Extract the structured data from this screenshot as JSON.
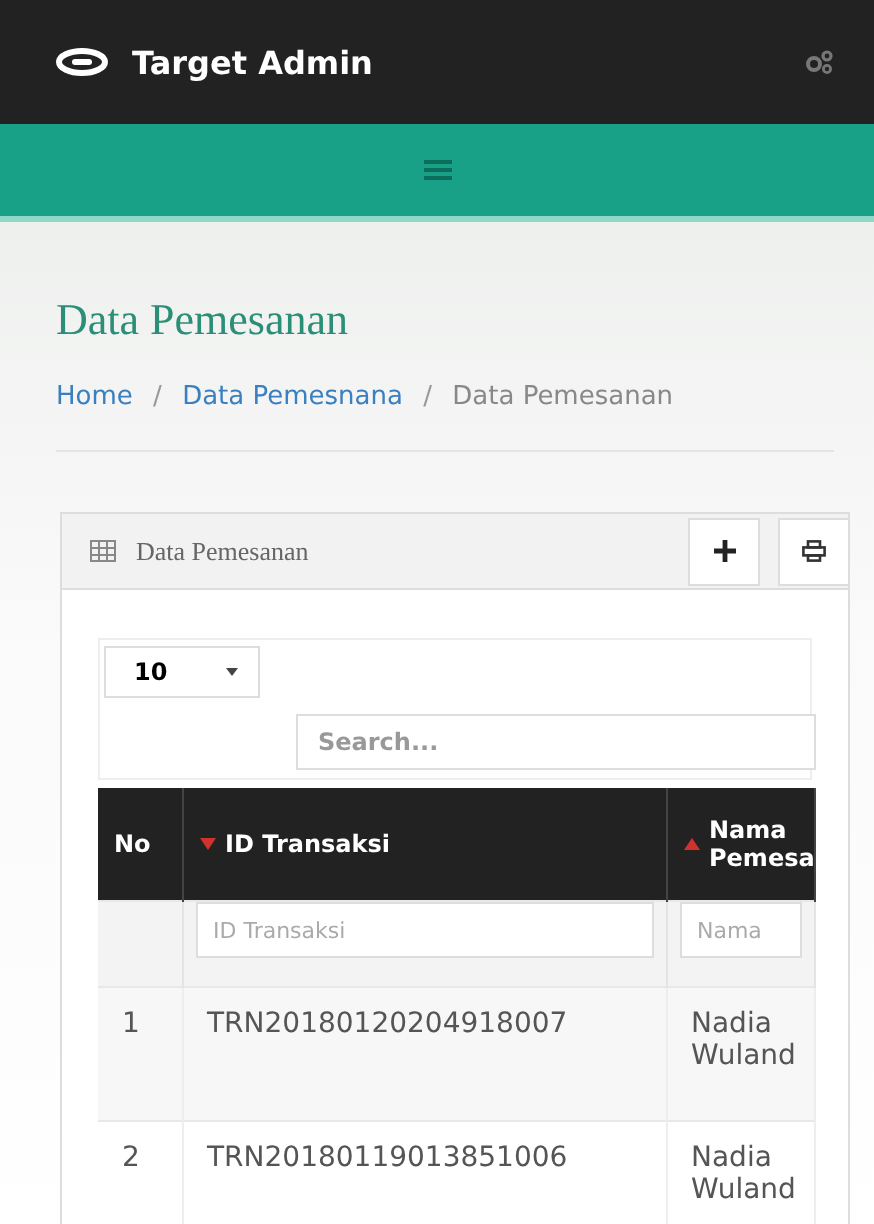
{
  "navbar": {
    "brand": "Target Admin"
  },
  "page": {
    "title": "Data Pemesanan",
    "breadcrumb": [
      {
        "label": "Home",
        "link": true
      },
      {
        "separator": "/"
      },
      {
        "label": "Data Pemesnana",
        "link": true
      },
      {
        "separator": "/"
      },
      {
        "label": "Data Pemesanan",
        "link": false
      }
    ]
  },
  "panel": {
    "title": "Data Pemesanan",
    "page_size": "10",
    "search": {
      "placeholder": "Search..."
    },
    "table": {
      "columns": [
        {
          "label": "No",
          "kind": "plain"
        },
        {
          "label": "ID Transaksi",
          "kind": "sort-desc",
          "placeholder": "ID Transaksi"
        },
        {
          "label": "Nama Pemesa",
          "kind": "sort-asc",
          "placeholder": "Nama"
        }
      ],
      "rows": [
        [
          "1",
          "TRN20180120204918007",
          "Nadia Wuland"
        ],
        [
          "2",
          "TRN20180119013851006",
          "Nadia Wuland"
        ]
      ]
    }
  }
}
